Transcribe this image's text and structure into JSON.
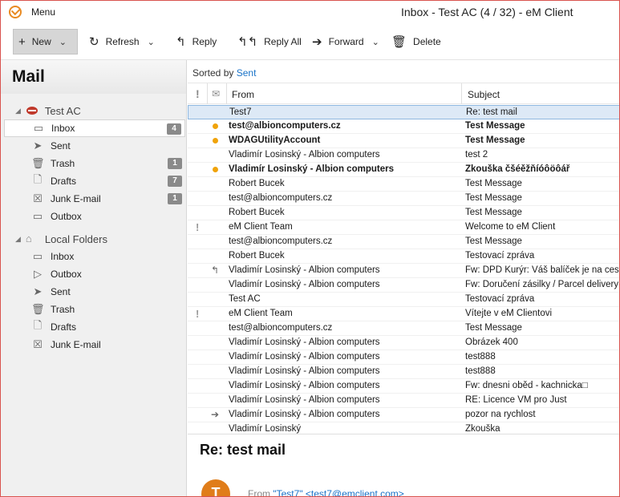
{
  "titlebar": {
    "menu_label": "Menu",
    "window_title": "Inbox - Test AC (4 / 32) - eM Client"
  },
  "toolbar": {
    "new_label": "New",
    "refresh_label": "Refresh",
    "reply_label": "Reply",
    "reply_all_label": "Reply All",
    "forward_label": "Forward",
    "delete_label": "Delete"
  },
  "sidebar": {
    "title": "Mail",
    "account1": {
      "name": "Test AC",
      "folders": [
        {
          "label": "Inbox",
          "icon": "inbox-icon",
          "badge": "4"
        },
        {
          "label": "Sent",
          "icon": "sent-icon",
          "badge": ""
        },
        {
          "label": "Trash",
          "icon": "trash-icon",
          "badge": "1"
        },
        {
          "label": "Drafts",
          "icon": "drafts-icon",
          "badge": "7"
        },
        {
          "label": "Junk E-mail",
          "icon": "junk-icon",
          "badge": "1"
        },
        {
          "label": "Outbox",
          "icon": "outbox-icon",
          "badge": ""
        }
      ]
    },
    "account2": {
      "name": "Local Folders",
      "folders": [
        {
          "label": "Inbox",
          "icon": "inbox-icon"
        },
        {
          "label": "Outbox",
          "icon": "outbox-icon"
        },
        {
          "label": "Sent",
          "icon": "sent-icon"
        },
        {
          "label": "Trash",
          "icon": "trash-icon"
        },
        {
          "label": "Drafts",
          "icon": "drafts-icon"
        },
        {
          "label": "Junk E-mail",
          "icon": "junk-icon"
        }
      ]
    }
  },
  "list": {
    "sorted_prefix": "Sorted by",
    "sorted_field": "Sent",
    "col_from": "From",
    "col_subject": "Subject",
    "rows": [
      {
        "from": "Test7",
        "subject": "Re: test mail",
        "unread": false,
        "flag": false,
        "status": "",
        "selected": true
      },
      {
        "from": "test@albioncomputers.cz",
        "subject": "Test Message",
        "unread": true,
        "flag": false,
        "status": "",
        "selected": false
      },
      {
        "from": "WDAGUtilityAccount",
        "subject": "Test Message",
        "unread": true,
        "flag": false,
        "status": "",
        "selected": false
      },
      {
        "from": "Vladimír Losinský - Albion computers",
        "subject": "test 2",
        "unread": false,
        "flag": false,
        "status": "",
        "selected": false
      },
      {
        "from": "Vladimír Losinský - Albion computers",
        "subject": "Zkouška čšéěžňíóôöôář",
        "unread": true,
        "flag": false,
        "status": "",
        "selected": false
      },
      {
        "from": "Robert Bucek",
        "subject": "Test Message",
        "unread": false,
        "flag": false,
        "status": "",
        "selected": false
      },
      {
        "from": "test@albioncomputers.cz",
        "subject": "Test Message",
        "unread": false,
        "flag": false,
        "status": "",
        "selected": false
      },
      {
        "from": "Robert Bucek",
        "subject": "Test Message",
        "unread": false,
        "flag": false,
        "status": "",
        "selected": false
      },
      {
        "from": "eM Client Team",
        "subject": "Welcome to eM Client",
        "unread": false,
        "flag": true,
        "status": "",
        "selected": false
      },
      {
        "from": "test@albioncomputers.cz",
        "subject": "Test Message",
        "unread": false,
        "flag": false,
        "status": "",
        "selected": false
      },
      {
        "from": "Robert Bucek",
        "subject": "Testovací zpráva",
        "unread": false,
        "flag": false,
        "status": "",
        "selected": false
      },
      {
        "from": "Vladimír Losinský - Albion computers",
        "subject": "Fw: DPD Kurýr: Váš balíček je na cestě",
        "unread": false,
        "flag": false,
        "status": "replied",
        "selected": false
      },
      {
        "from": "Vladimír Losinský - Albion computers",
        "subject": "Fw: Doručení zásilky / Parcel delivery / Ü",
        "unread": false,
        "flag": false,
        "status": "",
        "selected": false
      },
      {
        "from": "Test AC",
        "subject": "Testovací zpráva",
        "unread": false,
        "flag": false,
        "status": "",
        "selected": false
      },
      {
        "from": "eM Client Team",
        "subject": "Vítejte v eM Clientovi",
        "unread": false,
        "flag": true,
        "status": "",
        "selected": false
      },
      {
        "from": "test@albioncomputers.cz",
        "subject": "Test Message",
        "unread": false,
        "flag": false,
        "status": "",
        "selected": false
      },
      {
        "from": "Vladimír Losinský - Albion computers",
        "subject": "Obrázek 400",
        "unread": false,
        "flag": false,
        "status": "",
        "selected": false
      },
      {
        "from": "Vladimír Losinský - Albion computers",
        "subject": "test888",
        "unread": false,
        "flag": false,
        "status": "",
        "selected": false
      },
      {
        "from": "Vladimír Losinský - Albion computers",
        "subject": "test888",
        "unread": false,
        "flag": false,
        "status": "",
        "selected": false
      },
      {
        "from": "Vladimír Losinský - Albion computers",
        "subject": "Fw: dnesni oběd - kachnicka□",
        "unread": false,
        "flag": false,
        "status": "",
        "selected": false
      },
      {
        "from": "Vladimír Losinský - Albion computers",
        "subject": "RE: Licence VM pro Just",
        "unread": false,
        "flag": false,
        "status": "",
        "selected": false
      },
      {
        "from": "Vladimír Losinský - Albion computers",
        "subject": "pozor na rychlost",
        "unread": false,
        "flag": false,
        "status": "forwarded",
        "selected": false
      },
      {
        "from": "Vladimír Losinský",
        "subject": "Zkouška",
        "unread": false,
        "flag": false,
        "status": "",
        "selected": false
      }
    ]
  },
  "reading": {
    "title": "Re: test mail",
    "avatar_letter": "T",
    "from_prefix": "From",
    "from_name": "\"Test7\"",
    "from_email": "<test7@emclient.com>"
  },
  "colors": {
    "accent": "#1a73c8",
    "unread_dot": "#f0a30a",
    "avatar": "#e07d1a",
    "badge": "#8a8a8a"
  }
}
